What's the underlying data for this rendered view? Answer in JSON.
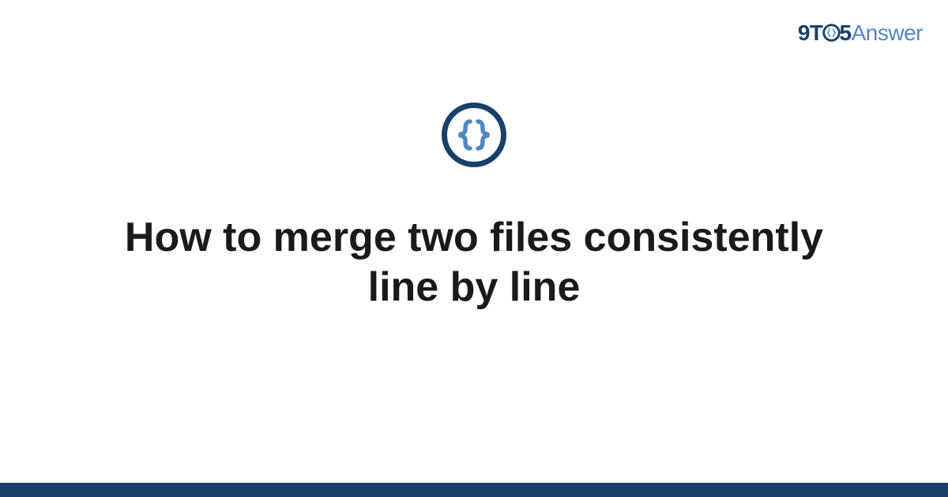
{
  "brand": {
    "part1": "9T",
    "part2": "5",
    "part3": "Answer",
    "colors": {
      "dark": "#18406a",
      "light": "#5186c4"
    }
  },
  "icon": {
    "name": "curly-braces",
    "brace_color": "#5186c4",
    "ring_color": "#18406a"
  },
  "title": "How to merge two files consistently line by line"
}
